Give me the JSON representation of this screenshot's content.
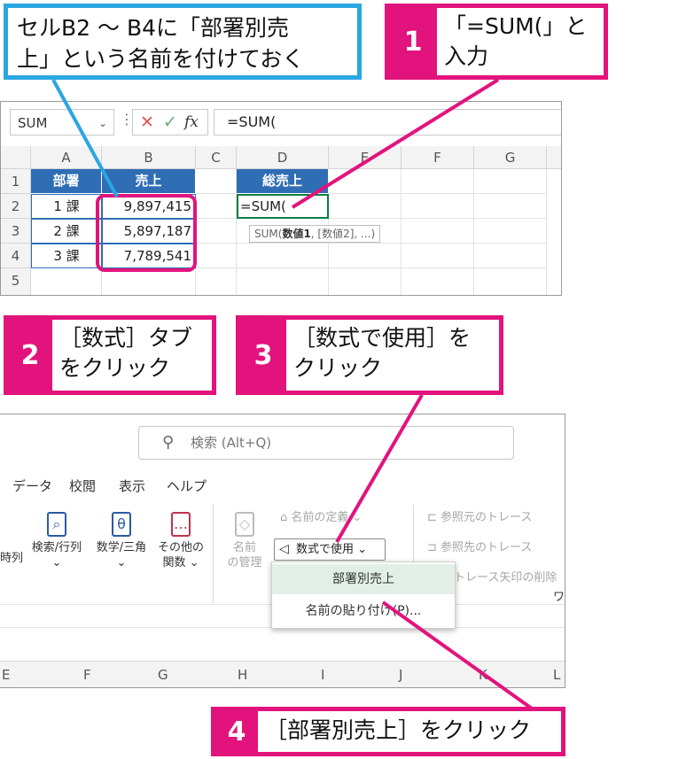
{
  "callouts": {
    "name_note": {
      "line1": "セルB2 ～ B4に「部署別売",
      "line2": "上」という名前を付けておく"
    },
    "step1": {
      "num": "1",
      "line1": "「=SUM(」と",
      "line2": "入力"
    },
    "step2": {
      "num": "2",
      "line1": "［数式］タブ",
      "line2": "をクリック"
    },
    "step3": {
      "num": "3",
      "line1": "［数式で使用］を",
      "line2": "クリック"
    },
    "step4": {
      "num": "4",
      "text": "［部署別売上］をクリック"
    }
  },
  "formula_bar": {
    "name_box": "SUM",
    "cancel_icon": "✕",
    "enter_icon": "✓",
    "fx_icon": "fx",
    "value": "=SUM("
  },
  "sheet": {
    "columns": [
      "A",
      "B",
      "C",
      "D",
      "E",
      "F",
      "G"
    ],
    "rows": [
      "1",
      "2",
      "3",
      "4",
      "5"
    ],
    "headers": {
      "A1": "部署",
      "B1": "売上",
      "D1": "総売上"
    },
    "data": [
      {
        "dept": "1 課",
        "sales": "9,897,415"
      },
      {
        "dept": "2 課",
        "sales": "5,897,187"
      },
      {
        "dept": "3 課",
        "sales": "7,789,541"
      }
    ],
    "active_cell_value": "=SUM(",
    "tooltip_prefix": "SUM(",
    "tooltip_bold": "数値1",
    "tooltip_rest": ", [数値2], ...)"
  },
  "ribbon": {
    "search_placeholder": "検索 (Alt+Q)",
    "tabs": [
      "データ",
      "校閲",
      "表示",
      "ヘルプ"
    ],
    "partial_left_label": "時列",
    "buttons": {
      "lookup": {
        "line1": "検索/行列",
        "line2": "⌄"
      },
      "math": {
        "line1": "数学/三角",
        "line2": "⌄"
      },
      "other": {
        "line1": "その他の",
        "line2": "関数 ⌄"
      },
      "name_manager": {
        "line1": "名前",
        "line2": "の管理"
      },
      "define_name": "名前の定義 ⌄",
      "use_in_formula": "数式で使用 ⌄",
      "trace_precedents": "参照元のトレース",
      "trace_dependents": "参照先のトレース",
      "remove_arrows": "トレース矢印の削除",
      "partial_right": "ワ"
    },
    "dropdown": [
      "部署別売上",
      "名前の貼り付け(P)..."
    ],
    "columns": [
      "E",
      "F",
      "G",
      "H",
      "I",
      "J",
      "K",
      "L"
    ]
  },
  "colors": {
    "pink": "#e2137d",
    "blue": "#2aa6e1",
    "excel_header": "#2f6db5",
    "excel_green": "#107c41"
  }
}
